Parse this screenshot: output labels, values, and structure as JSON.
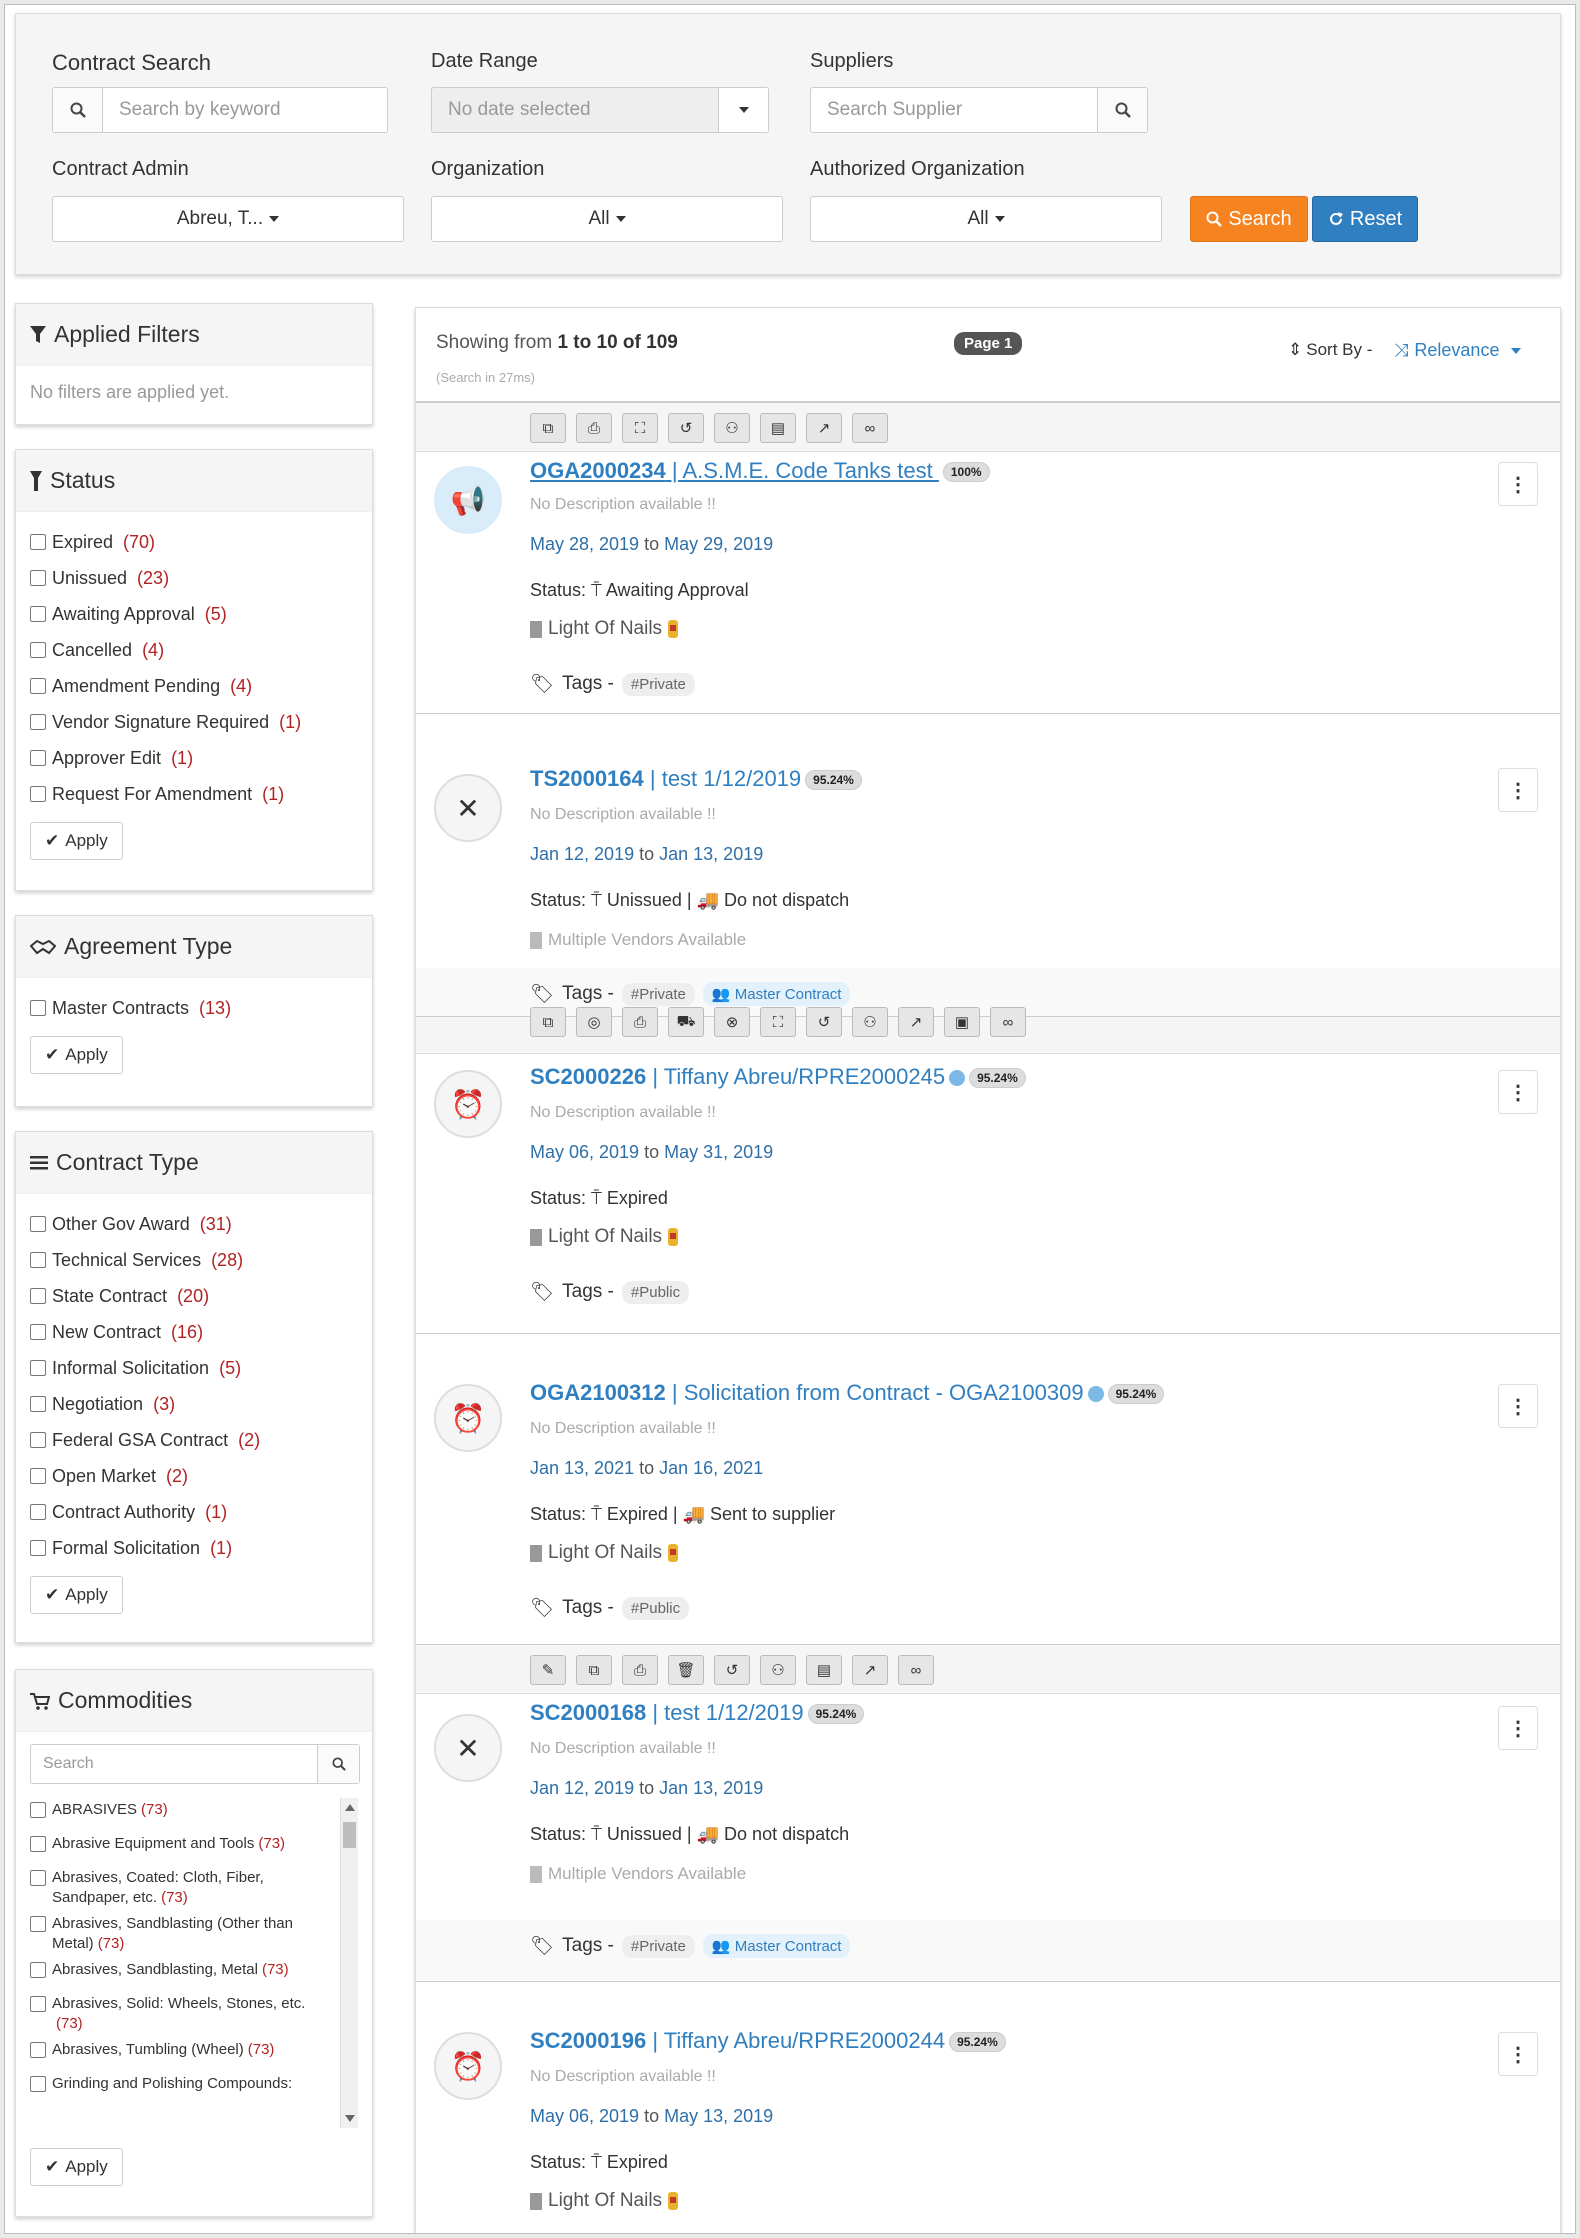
{
  "search": {
    "contract_search_label": "Contract Search",
    "keyword_placeholder": "Search by keyword",
    "date_range_label": "Date Range",
    "date_range_value": "No date selected",
    "suppliers_label": "Suppliers",
    "supplier_placeholder": "Search Supplier",
    "contract_admin_label": "Contract Admin",
    "contract_admin_value": "Abreu, T...",
    "organization_label": "Organization",
    "organization_value": "All",
    "auth_org_label": "Authorized Organization",
    "auth_org_value": "All",
    "search_button": "Search",
    "reset_button": "Reset"
  },
  "applied_filters": {
    "title": "Applied Filters",
    "empty_text": "No filters are applied yet."
  },
  "status_filter": {
    "title": "Status",
    "items": [
      {
        "label": "Expired",
        "count": "(70)"
      },
      {
        "label": "Unissued",
        "count": "(23)"
      },
      {
        "label": "Awaiting Approval",
        "count": "(5)"
      },
      {
        "label": "Cancelled",
        "count": "(4)"
      },
      {
        "label": "Amendment Pending",
        "count": "(4)"
      },
      {
        "label": "Vendor Signature Required",
        "count": "(1)"
      },
      {
        "label": "Approver Edit",
        "count": "(1)"
      },
      {
        "label": "Request For Amendment",
        "count": "(1)"
      }
    ],
    "apply": "Apply"
  },
  "agreement_filter": {
    "title": "Agreement Type",
    "items": [
      {
        "label": "Master Contracts",
        "count": "(13)"
      }
    ],
    "apply": "Apply"
  },
  "contract_type_filter": {
    "title": "Contract Type",
    "items": [
      {
        "label": "Other Gov Award",
        "count": "(31)"
      },
      {
        "label": "Technical Services",
        "count": "(28)"
      },
      {
        "label": "State Contract",
        "count": "(20)"
      },
      {
        "label": "New Contract",
        "count": "(16)"
      },
      {
        "label": "Informal Solicitation",
        "count": "(5)"
      },
      {
        "label": "Negotiation",
        "count": "(3)"
      },
      {
        "label": "Federal GSA Contract",
        "count": "(2)"
      },
      {
        "label": "Open Market",
        "count": "(2)"
      },
      {
        "label": "Contract Authority",
        "count": "(1)"
      },
      {
        "label": "Formal Solicitation",
        "count": "(1)"
      }
    ],
    "apply": "Apply"
  },
  "commodities_filter": {
    "title": "Commodities",
    "search_placeholder": "Search",
    "items": [
      {
        "label": "ABRASIVES",
        "count": "(73)"
      },
      {
        "label": "Abrasive Equipment and Tools",
        "count": "(73)"
      },
      {
        "label": "Abrasives, Coated: Cloth, Fiber, Sandpaper, etc.",
        "count": "(73)"
      },
      {
        "label": "Abrasives, Sandblasting (Other than Metal)",
        "count": "(73)"
      },
      {
        "label": "Abrasives, Sandblasting, Metal",
        "count": "(73)"
      },
      {
        "label": "Abrasives, Solid: Wheels, Stones, etc.",
        "count": "(73)"
      },
      {
        "label": "Abrasives, Tumbling (Wheel)",
        "count": "(73)"
      },
      {
        "label": "Grinding and Polishing Compounds:",
        "count": ""
      }
    ],
    "apply": "Apply"
  },
  "results": {
    "showing_prefix": "Showing from ",
    "showing_range": "1 to 10 of 109",
    "search_time": "(Search in 27ms)",
    "page_badge": "Page 1",
    "sort_by": "Sort By -",
    "sort_value": "Relevance",
    "status_prefix": "Status:",
    "tags_prefix": "Tags -",
    "to_word": "to",
    "cards": [
      {
        "id": "OGA2000234",
        "title": " | A.S.M.E. Code Tanks test ",
        "pct": "100%",
        "desc": "No Description available !!",
        "start": "May 28, 2019",
        "end": "May 29, 2019",
        "status": "Awaiting Approval",
        "dispatch": "",
        "vendor": "Light Of Nails",
        "tags": [
          "#Private"
        ],
        "master": ""
      },
      {
        "id": "TS2000164",
        "title": " | test 1/12/2019",
        "pct": "95.24%",
        "desc": "No Description available !!",
        "start": "Jan 12, 2019",
        "end": "Jan 13, 2019",
        "status": "Unissued",
        "dispatch": "Do not dispatch",
        "vendor": "Multiple Vendors Available",
        "tags": [
          "#Private"
        ],
        "master": "Master Contract"
      },
      {
        "id": "SC2000226",
        "title": " | Tiffany Abreu/RPRE2000245",
        "pct": "95.24%",
        "desc": "No Description available !!",
        "start": "May 06, 2019",
        "end": "May 31, 2019",
        "status": "Expired",
        "dispatch": "",
        "vendor": "Light Of Nails",
        "tags": [
          "#Public"
        ],
        "master": ""
      },
      {
        "id": "OGA2100312",
        "title": " | Solicitation from Contract - OGA2100309",
        "pct": "95.24%",
        "desc": "No Description available !!",
        "start": "Jan 13, 2021",
        "end": "Jan 16, 2021",
        "status": "Expired",
        "dispatch": "Sent to supplier",
        "vendor": "Light Of Nails",
        "tags": [
          "#Public"
        ],
        "master": ""
      },
      {
        "id": "SC2000168",
        "title": " | test 1/12/2019",
        "pct": "95.24%",
        "desc": "No Description available !!",
        "start": "Jan 12, 2019",
        "end": "Jan 13, 2019",
        "status": "Unissued",
        "dispatch": "Do not dispatch",
        "vendor": "Multiple Vendors Available",
        "tags": [
          "#Private"
        ],
        "master": "Master Contract"
      },
      {
        "id": "SC2000196",
        "title": " | Tiffany Abreu/RPRE2000244",
        "pct": "95.24%",
        "desc": "No Description available !!",
        "start": "May 06, 2019",
        "end": "May 13, 2019",
        "status": "Expired",
        "dispatch": "",
        "vendor": "Light Of Nails",
        "tags": [],
        "master": ""
      }
    ]
  }
}
